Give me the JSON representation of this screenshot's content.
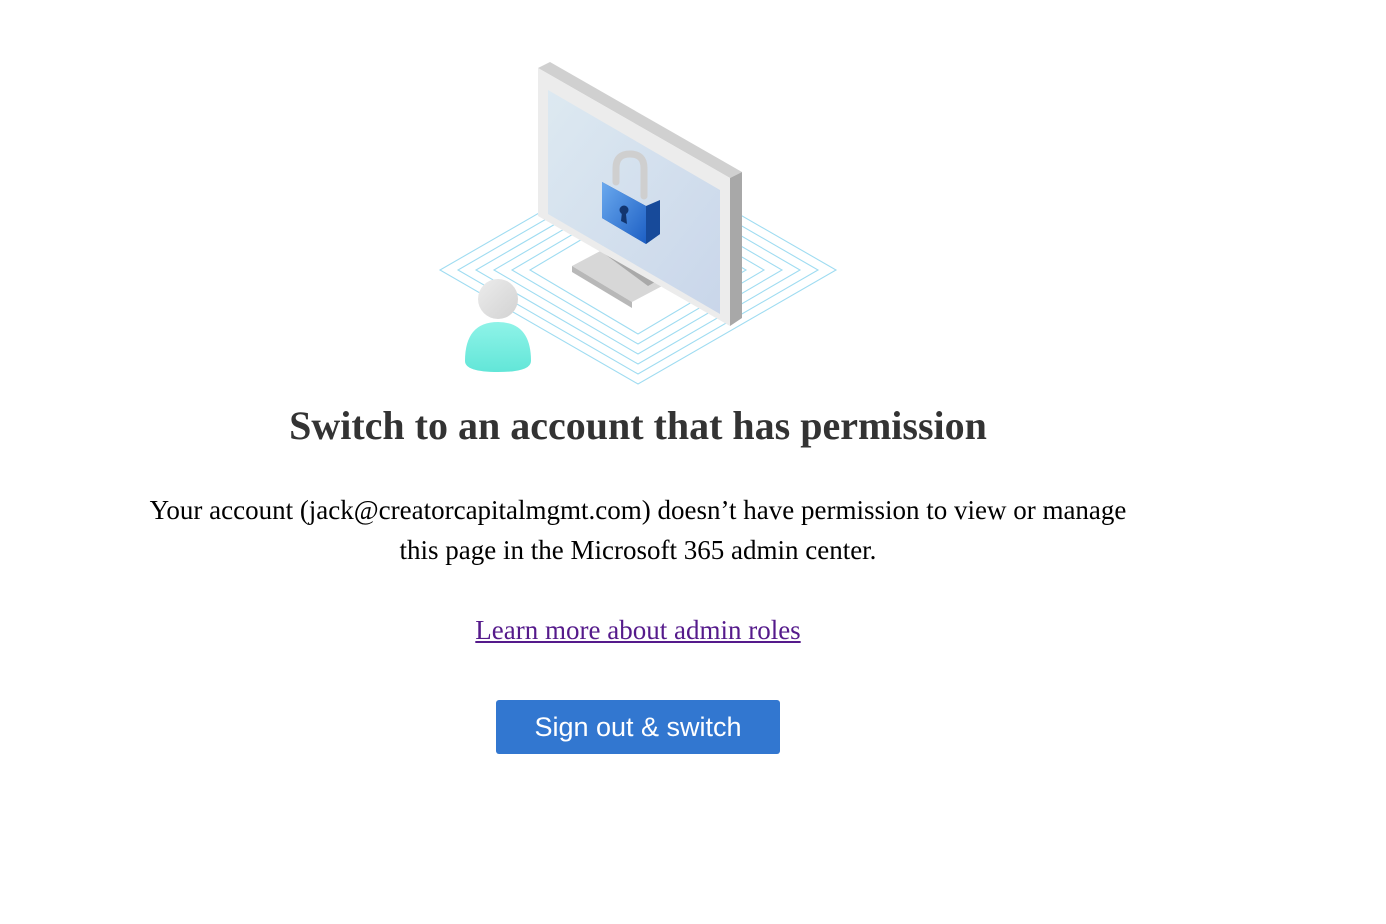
{
  "illustration": {
    "icons": [
      "monitor-icon",
      "padlock-icon",
      "user-icon"
    ]
  },
  "heading": "Switch to an account that has permission",
  "message": {
    "line1": "Your account (jack@creatorcapitalmgmt.com) doesn’t have permission to view or manage",
    "line2": "this page in the Microsoft 365 admin center."
  },
  "link": {
    "label": "Learn more about admin roles"
  },
  "button": {
    "label": "Sign out & switch",
    "color": "#3277d0"
  },
  "colors": {
    "heading": "#333333",
    "link_visited": "#551a8b",
    "user_head": "#e0e0e0",
    "user_body": "#7eeee2",
    "lock": "#2f73cc",
    "grid_lines": "#7fd0ee"
  }
}
